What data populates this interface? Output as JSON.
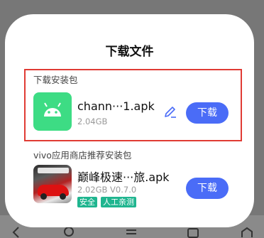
{
  "dialog": {
    "title": "下载文件",
    "package_section_label": "下载安装包",
    "store_section_label": "vivo应用商店推荐安装包"
  },
  "package": {
    "name": "chann···1.apk",
    "size": "2.04GB",
    "download_label": "下载"
  },
  "recommended": {
    "name": "巅峰极速···旅.apk",
    "meta": "2.02GB  V0.7.0",
    "badges": [
      "安全",
      "人工亲测"
    ],
    "download_label": "下载"
  },
  "colors": {
    "accent": "#4a6cf7",
    "highlight": "#e03b34",
    "android": "#3ddc84",
    "badge": "#1fb58f"
  },
  "icons": [
    "android-icon",
    "edit-icon",
    "game-icon",
    "back-icon",
    "search-icon",
    "menu-icon",
    "tabs-icon",
    "home-icon"
  ]
}
